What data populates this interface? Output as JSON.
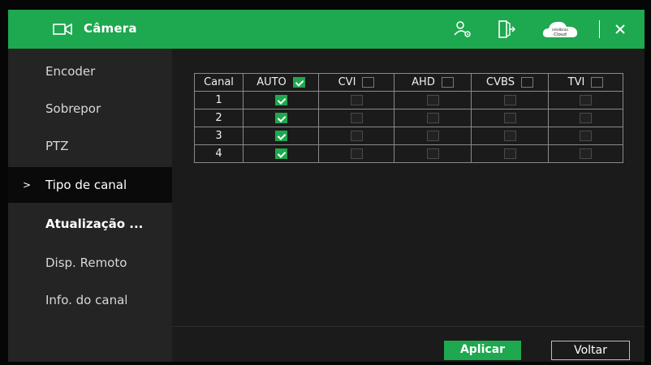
{
  "titlebar": {
    "title": "Câmera",
    "icons": [
      "camera-icon",
      "user-settings-icon",
      "logout-icon",
      "cloud-icon",
      "close-icon"
    ],
    "cloud_brand": "intelbras",
    "cloud_label": "Cloud"
  },
  "sidebar": {
    "items": [
      {
        "label": "Encoder"
      },
      {
        "label": "Sobrepor"
      },
      {
        "label": "PTZ"
      },
      {
        "label": "Tipo de canal",
        "active": true,
        "marker": ">"
      },
      {
        "label": "Atualização ..."
      },
      {
        "label": "Disp. Remoto"
      },
      {
        "label": "Info. do canal"
      }
    ]
  },
  "table": {
    "headers": {
      "canal": "Canal",
      "auto": "AUTO",
      "cvi": "CVI",
      "ahd": "AHD",
      "cvbs": "CVBS",
      "tvi": "TVI"
    },
    "header_checked": {
      "auto": true,
      "cvi": false,
      "ahd": false,
      "cvbs": false,
      "tvi": false
    },
    "rows": [
      {
        "canal": "1",
        "auto": true,
        "cvi": false,
        "ahd": false,
        "cvbs": false,
        "tvi": false
      },
      {
        "canal": "2",
        "auto": true,
        "cvi": false,
        "ahd": false,
        "cvbs": false,
        "tvi": false
      },
      {
        "canal": "3",
        "auto": true,
        "cvi": false,
        "ahd": false,
        "cvbs": false,
        "tvi": false
      },
      {
        "canal": "4",
        "auto": true,
        "cvi": false,
        "ahd": false,
        "cvbs": false,
        "tvi": false
      }
    ]
  },
  "buttons": {
    "apply": "Aplicar",
    "back": "Voltar"
  },
  "colors": {
    "accent": "#1ea84f",
    "sidebar_bg": "#242424",
    "content_bg": "#1b1b1b"
  }
}
